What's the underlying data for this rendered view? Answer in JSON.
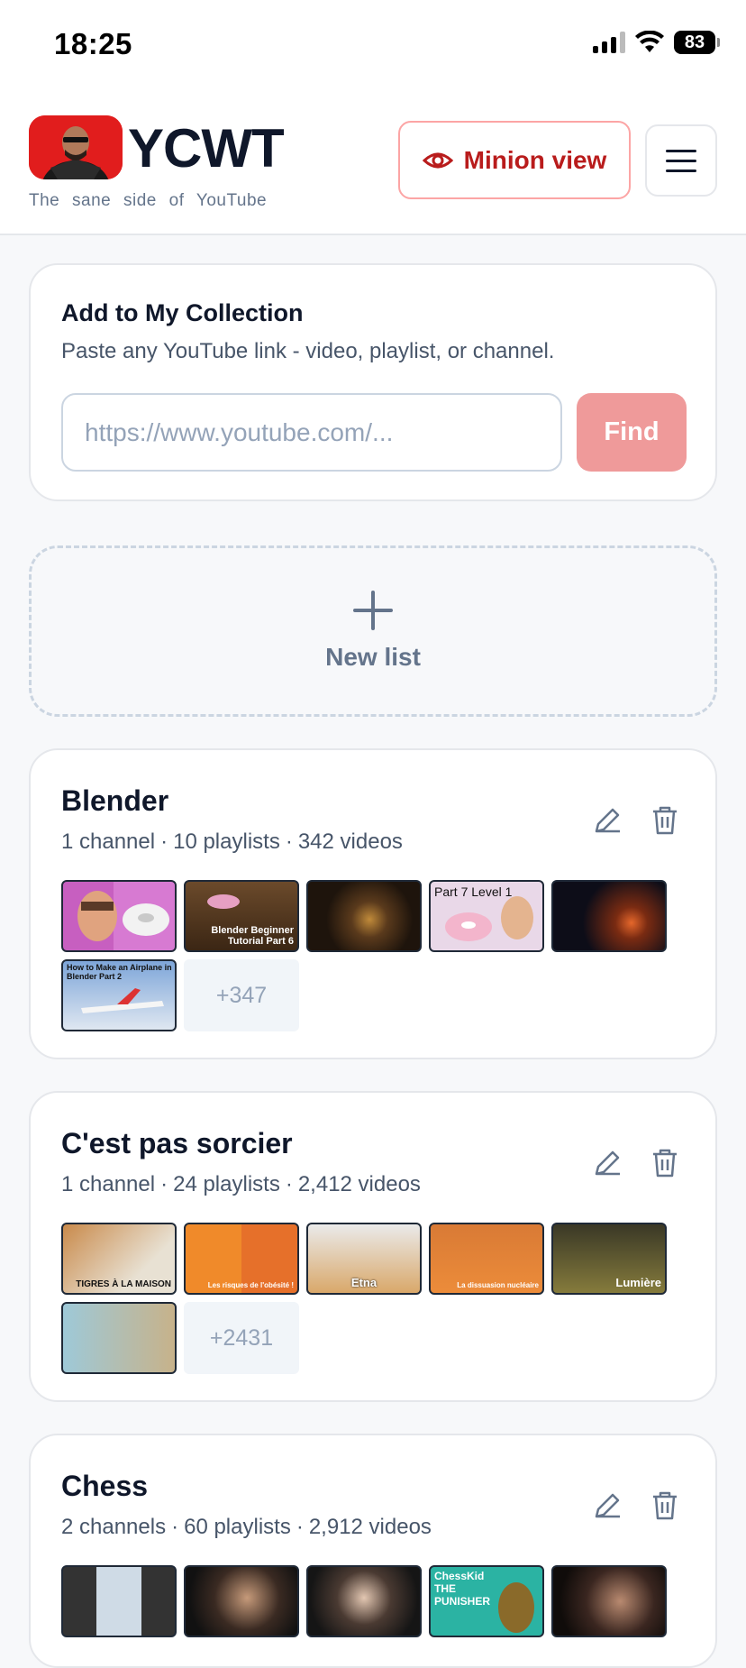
{
  "status": {
    "time": "18:25",
    "battery": "83"
  },
  "header": {
    "app_title": "YCWT",
    "tagline": "The sane side of YouTube",
    "minion_label": "Minion view"
  },
  "add": {
    "title": "Add to My Collection",
    "subtitle": "Paste any YouTube link - video, playlist, or channel.",
    "placeholder": "https://www.youtube.com/...",
    "find_label": "Find"
  },
  "new_list": {
    "label": "New list"
  },
  "lists": [
    {
      "title": "Blender",
      "channels": "1 channel",
      "playlists": "10 playlists",
      "videos": "342 videos",
      "more": "+347",
      "thumb_captions": [
        "",
        "Blender Beginner Tutorial Part 6",
        "",
        "Part 7 Level 1",
        "",
        "How to Make an Airplane in Blender Part 2"
      ]
    },
    {
      "title": "C'est pas sorcier",
      "channels": "1 channel",
      "playlists": "24 playlists",
      "videos": "2,412 videos",
      "more": "+2431",
      "thumb_captions": [
        "TIGRES À LA MAISON",
        "Les risques de l'obésité !",
        "Etna",
        "La dissuasion nucléaire",
        "Lumière",
        ""
      ]
    },
    {
      "title": "Chess",
      "channels": "2 channels",
      "playlists": "60 playlists",
      "videos": "2,912 videos",
      "thumb_captions": [
        "",
        "",
        "",
        "ChessKid THE PUNISHER",
        ""
      ]
    }
  ],
  "colors": {
    "accent": "#b91c1c",
    "find_button": "#ef9a9a",
    "logo_red": "#e11d1d"
  }
}
